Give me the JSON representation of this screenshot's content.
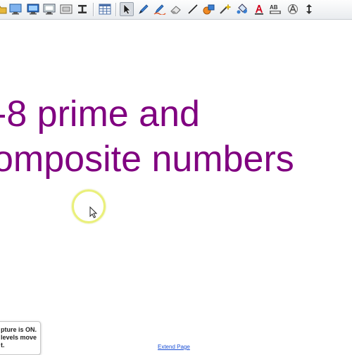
{
  "toolbar": {
    "tools": [
      {
        "name": "folder-icon",
        "color": "#e6b73a"
      },
      {
        "name": "monitor-icon",
        "color": "#2a6cc4"
      },
      {
        "name": "monitor-display-icon",
        "color": "#2a6cc4"
      },
      {
        "name": "monitor-blank-icon",
        "color": "#2a6cc4"
      },
      {
        "name": "screen-capture-icon",
        "color": "#555555"
      },
      {
        "name": "text-cursor-icon",
        "color": "#333333"
      },
      {
        "name": "table-icon",
        "color": "#4a6fa8"
      },
      {
        "name": "select-arrow-icon",
        "color": "#1d1d1d",
        "active": true
      },
      {
        "name": "pen-icon",
        "color": "#3b7fd1"
      },
      {
        "name": "creative-pen-icon",
        "color": "#3b7fd1"
      },
      {
        "name": "eraser-icon",
        "color": "#777777"
      },
      {
        "name": "line-icon",
        "color": "#222222"
      },
      {
        "name": "shapes-icon",
        "color": "#f08a24"
      },
      {
        "name": "magic-pen-icon",
        "color": "#e0b000"
      },
      {
        "name": "fill-icon",
        "color": "#3b7fd1"
      },
      {
        "name": "text-icon",
        "color": "#d0021b"
      },
      {
        "name": "highlight-text-icon",
        "color": "#444444"
      },
      {
        "name": "handwriting-icon",
        "color": "#555555"
      },
      {
        "name": "move-arrows-icon",
        "color": "#333333"
      }
    ]
  },
  "canvas": {
    "title_line1": "-8 prime and",
    "title_line2": "omposite numbers",
    "title_color": "#800080"
  },
  "toast": {
    "line1": "pture is ON.",
    "line2": "levels move",
    "line3": "t."
  },
  "footer": {
    "extend_page": "Extend Page"
  }
}
